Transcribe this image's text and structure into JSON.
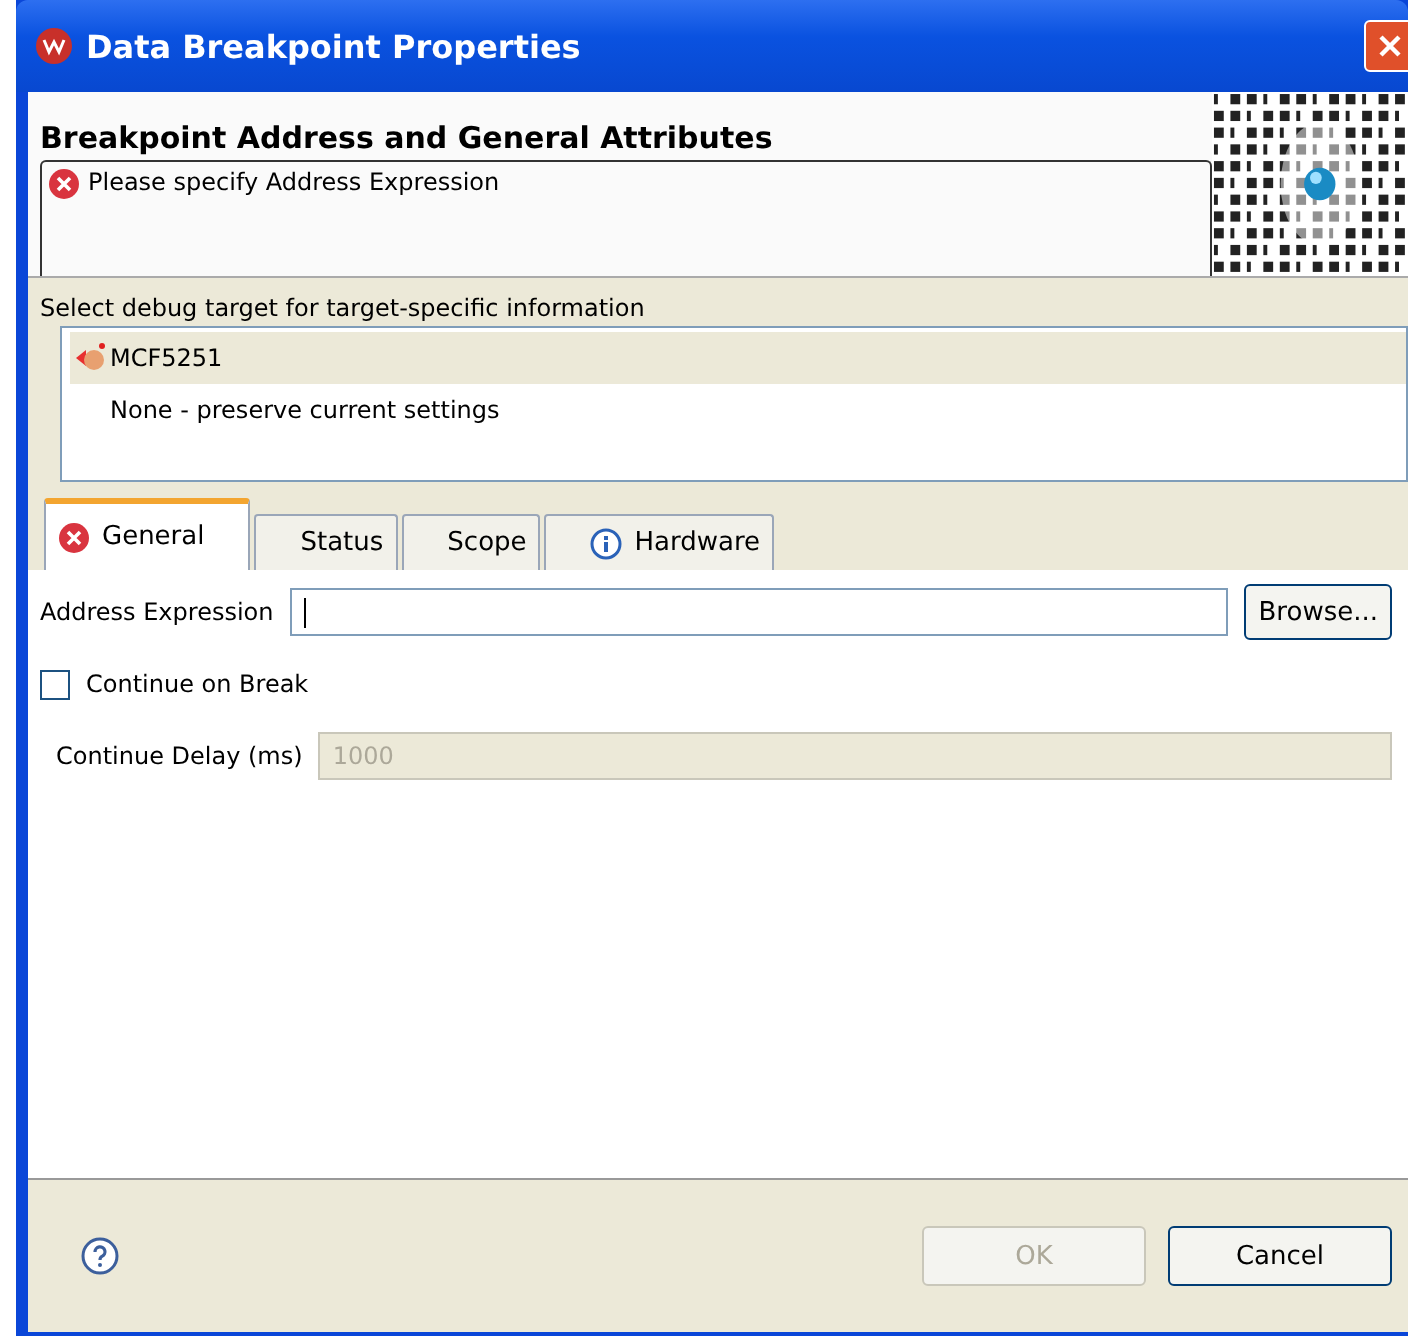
{
  "window": {
    "title": "Data Breakpoint Properties"
  },
  "header": {
    "title": "Breakpoint Address and General Attributes",
    "message": "Please specify Address Expression",
    "kind": "error"
  },
  "targets": {
    "label": "Select debug target for target-specific information",
    "items": [
      {
        "label": "MCF5251",
        "selected": true,
        "kind": "board"
      },
      {
        "label": "None - preserve current settings",
        "selected": false,
        "kind": "plain"
      }
    ]
  },
  "tabs": [
    {
      "label": "General",
      "selected": true,
      "kind": "error"
    },
    {
      "label": "Status",
      "selected": false,
      "kind": "plain"
    },
    {
      "label": "Scope",
      "selected": false,
      "kind": "plain"
    },
    {
      "label": "Hardware",
      "selected": false,
      "kind": "info"
    }
  ],
  "form": {
    "address_label": "Address Expression",
    "browse": "Browse...",
    "continue_label": "Continue on Break",
    "continue_checked": false,
    "delay_label": "Continue Delay (ms)",
    "delay_value": "1000",
    "delay_disabled": true
  },
  "buttons": [
    {
      "label": "OK",
      "disabled": true
    },
    {
      "label": "Cancel",
      "disabled": false
    }
  ]
}
